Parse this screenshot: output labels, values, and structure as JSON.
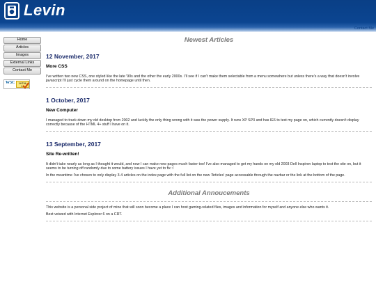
{
  "header": {
    "title": "Levin",
    "contact_link": "Contact Me"
  },
  "nav": {
    "items": [
      {
        "label": "Home"
      },
      {
        "label": "Articles"
      },
      {
        "label": "Images"
      },
      {
        "label": "External Links"
      },
      {
        "label": "Contact Me"
      }
    ]
  },
  "badge": {
    "w3c": "W3C",
    "xhtml": "XHTML 1.1"
  },
  "main": {
    "newest_heading": "Newest Articles",
    "articles": [
      {
        "date": "12 November, 2017",
        "title": "More CSS",
        "paragraphs": [
          "I've written two new CSS, one styled like the late '90s and the other the early 2000s. I'll see if I can't make them selectable from a menu somewhere but unless there's a way that doesn't involve javascript I'll just cycle them around on the homepage until then."
        ]
      },
      {
        "date": "1 October, 2017",
        "title": "New Computer",
        "paragraphs": [
          "I managed to track down my old desktop from 2002 and luckily the only thing wrong with it was the power supply. It runs XP SP3 and has IE6 to test my page on, which currently doesn't display correctly because of the HTML 4+ stuff I have on it."
        ]
      },
      {
        "date": "13 September, 2017",
        "title": "Site Re-written!",
        "paragraphs": [
          "It didn't take nearly as long as I thought it would, and now I can make new pages much faster too! I've also managed to get my hands on my old 2003 Dell Inspiron laptop to test the site on, but it seems to be turning off randomly due to some battery issues I have yet to fix :/",
          "In the meantime I've chosen to only display 3-4 articles on the index page with the full list on the new 'Articles' page accessable through the navbar or the link at the bottom of the page."
        ]
      }
    ],
    "additional_heading": "Additional Annoucements",
    "announcements": [
      "This website is a personal side project of mine that will soon become a place I can host gaming-related files, images and information for myself and anyone else who wants it.",
      "Best veiwed with Internet Explorer 6 on a CRT."
    ]
  }
}
